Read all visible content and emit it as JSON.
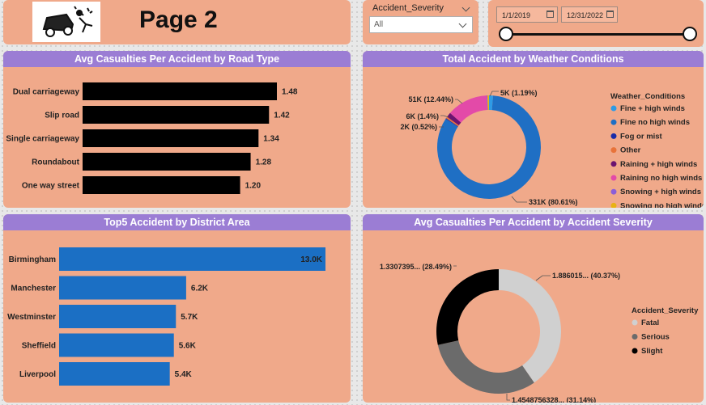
{
  "header": {
    "page_title": "Page 2",
    "severity_slicer": {
      "label": "Accident_Severity",
      "selected": "All"
    },
    "date_slicer": {
      "start": "1/1/2019",
      "end": "12/31/2022"
    }
  },
  "colors": {
    "panel_bg": "#f0a98a",
    "title_bar": "#9b7dd4",
    "bar_black": "#000000",
    "bar_blue": "#1b6fc4"
  },
  "road_type_chart": {
    "title": "Avg Casualties Per Accident by Road Type",
    "chart_data": {
      "type": "bar",
      "orientation": "horizontal",
      "categories": [
        "Dual carriageway",
        "Slip road",
        "Single carriageway",
        "Roundabout",
        "One way street"
      ],
      "values": [
        1.48,
        1.42,
        1.34,
        1.28,
        1.2
      ],
      "labels": [
        "1.48",
        "1.42",
        "1.34",
        "1.28",
        "1.20"
      ],
      "color": "#000000"
    }
  },
  "weather_chart": {
    "title": "Total Accident by Weather Conditions",
    "legend_title": "Weather_Conditions",
    "chart_data": {
      "type": "pie",
      "donut": true,
      "series": [
        {
          "name": "Fine + high winds",
          "value": 5,
          "label": "5K (1.19%)",
          "color": "#2e9be6"
        },
        {
          "name": "Fine no high winds",
          "value": 331,
          "label": "331K (80.61%)",
          "color": "#1f6fc4"
        },
        {
          "name": "Fog or mist",
          "value": 1,
          "label": "",
          "color": "#1a2ca8"
        },
        {
          "name": "Other",
          "value": 2,
          "label": "2K (0.52%)",
          "color": "#e8733a"
        },
        {
          "name": "Raining + high winds",
          "value": 6,
          "label": "6K (1.4%)",
          "color": "#6b1470"
        },
        {
          "name": "Raining no high winds",
          "value": 51,
          "label": "51K (12.44%)",
          "color": "#e34aa8"
        },
        {
          "name": "Snowing + high winds",
          "value": 1,
          "label": "",
          "color": "#8b5ed8"
        },
        {
          "name": "Snowing no high winds",
          "value": 2,
          "label": "",
          "color": "#e8b214"
        }
      ],
      "legend_position": "right"
    }
  },
  "district_chart": {
    "title": "Top5 Accident by District Area",
    "chart_data": {
      "type": "bar",
      "orientation": "horizontal",
      "categories": [
        "Birmingham",
        "Manchester",
        "Westminster",
        "Sheffield",
        "Liverpool"
      ],
      "values": [
        13.0,
        6.2,
        5.7,
        5.6,
        5.4
      ],
      "labels": [
        "13.0K",
        "6.2K",
        "5.7K",
        "5.6K",
        "5.4K"
      ],
      "color": "#1b6fc4"
    }
  },
  "severity_chart": {
    "title": "Avg Casualties Per Accident by Accident Severity",
    "legend_title": "Accident_Severity",
    "chart_data": {
      "type": "pie",
      "donut": true,
      "series": [
        {
          "name": "Fatal",
          "value": 1.886015,
          "label": "1.886015... (40.37%)",
          "color": "#d0d0d0"
        },
        {
          "name": "Serious",
          "value": 1.4548756328,
          "label": "1.4548756328... (31.14%)",
          "color": "#6b6b6b"
        },
        {
          "name": "Slight",
          "value": 1.3307395,
          "label": "1.3307395... (28.49%)",
          "color": "#000000"
        }
      ],
      "legend_position": "right"
    }
  }
}
